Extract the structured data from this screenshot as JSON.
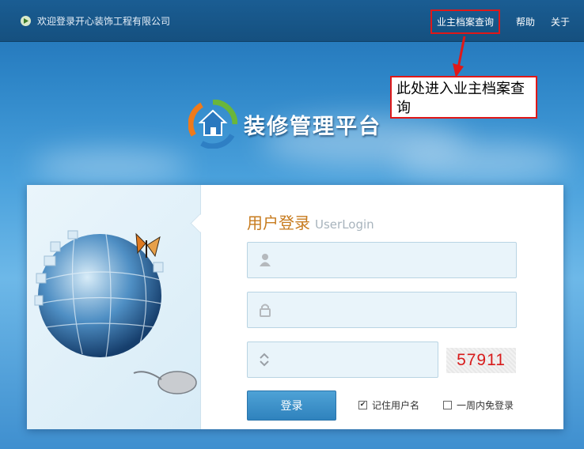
{
  "header": {
    "welcome": "欢迎登录开心装饰工程有限公司",
    "nav": [
      "业主档案查询",
      "帮助",
      "关于"
    ]
  },
  "annotation": {
    "callout_text": "此处进入业主档案查询"
  },
  "brand": {
    "title": "装修管理平台"
  },
  "login": {
    "title": "用户登录",
    "subtitle": "UserLogin",
    "username_placeholder": "",
    "password_placeholder": "",
    "captcha_placeholder": "",
    "captcha_code": "57911",
    "submit_label": "登录",
    "remember_user_label": "记住用户名",
    "remember_user_checked": true,
    "week_autologin_label": "一周内免登录",
    "week_autologin_checked": false
  },
  "colors": {
    "accent_red": "#e01818",
    "title_orange": "#c77b1e",
    "button_blue": "#3a8fc8"
  }
}
